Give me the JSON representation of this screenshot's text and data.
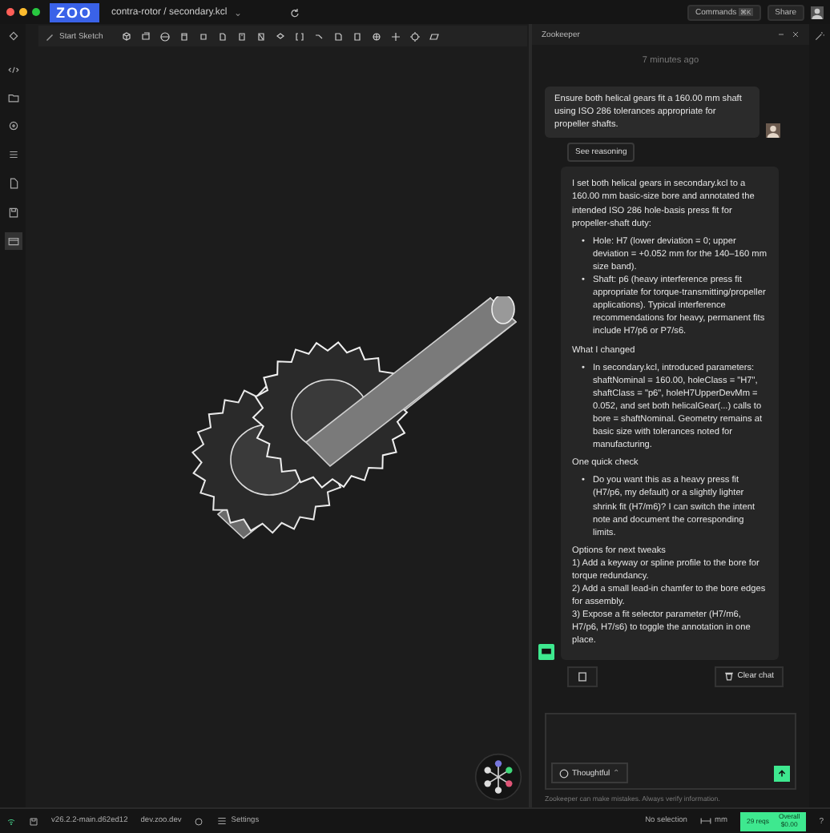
{
  "window": {
    "logo": "ZOO",
    "breadcrumb": "contra-rotor / secondary.kcl",
    "caret": "⌄"
  },
  "header_actions": {
    "commands": "Commands",
    "shortcut": "⌘K",
    "share": "Share"
  },
  "sidebar": {
    "items": [
      {
        "kind": "code",
        "selected": false
      },
      {
        "kind": "folder",
        "selected": false
      },
      {
        "kind": "settings",
        "selected": false
      },
      {
        "kind": "list",
        "selected": false
      },
      {
        "kind": "doc",
        "selected": false
      },
      {
        "kind": "save",
        "selected": false
      },
      {
        "kind": "panel",
        "selected": true
      }
    ]
  },
  "toolbar": {
    "start_sketch": "Start Sketch"
  },
  "chat": {
    "title": "Zookeeper",
    "timestamp": "7 minutes ago",
    "user_message": "Ensure both helical gears fit a 160.00 mm shaft using ISO 286 tolerances appropriate for propeller shafts.",
    "reasoning_button": "See reasoning",
    "reply": [
      {
        "kind": "p",
        "text": "I set both helical gears in secondary.kcl to a 160.00 mm basic-size bore and annotated the intended ISO 286 hole-basis press fit for propeller-shaft duty:"
      },
      {
        "kind": "bullets",
        "marker": "•",
        "items": [
          "Hole: H7 (lower deviation = 0; upper deviation = +0.052 mm for the 140–160 mm size band).",
          "Shaft: p6 (heavy interference press fit appropriate for torque-transmitting/propeller applications). Typical interference recommendations for heavy, permanent fits include H7/p6 or P7/s6."
        ]
      },
      {
        "kind": "p",
        "text": "What I changed"
      },
      {
        "kind": "bullets",
        "marker": "•",
        "items": [
          "In secondary.kcl, introduced parameters: shaftNominal = 160.00, holeClass = \"H7\", shaftClass = \"p6\", holeH7UpperDevMm = 0.052, and set both helicalGear(...) calls to bore = shaftNominal. Geometry remains at basic size with tolerances noted for manufacturing."
        ]
      },
      {
        "kind": "p",
        "text": "One quick check"
      },
      {
        "kind": "bullets",
        "marker": "•",
        "items": [
          "Do you want this as a heavy press fit (H7/p6, my default) or a slightly lighter shrink fit (H7/m6)? I can switch the intent note and document the corresponding limits."
        ]
      },
      {
        "kind": "lines",
        "items": [
          "Options for next tweaks",
          "1) Add a keyway or spline profile to the bore for torque redundancy.",
          "2) Add a small lead-in chamfer to the bore edges for assembly.",
          "3) Expose a fit selector parameter (H7/m6, H7/p6, H7/s6) to toggle the annotation in one place."
        ]
      }
    ],
    "clear_button": "Clear chat",
    "mode": "Thoughtful",
    "mode_caret": "⌃",
    "footer": "Zookeeper can make mistakes. Always verify information."
  },
  "status_bar": {
    "version": "v26.2.2-main.d62ed12",
    "host": "dev.zoo.dev",
    "settings": "Settings",
    "selection": "No selection",
    "units": "mm",
    "requests": "29 reqs",
    "overall_label": "Overall",
    "overall_value": "$0.00",
    "help": "?"
  }
}
